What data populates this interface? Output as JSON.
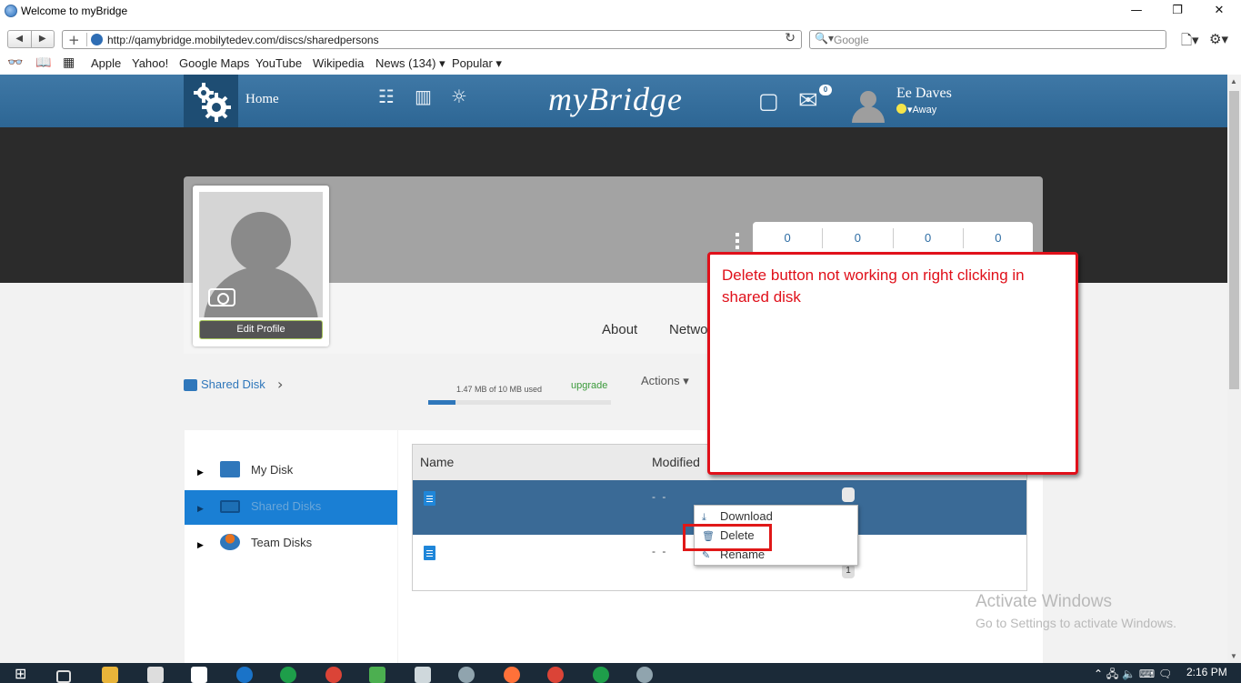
{
  "window": {
    "title": "Welcome to myBridge",
    "controls": [
      "—",
      "❐",
      "✕"
    ]
  },
  "browser": {
    "back_glyph": "◀",
    "forward_glyph": "▶",
    "new_tab_glyph": "+",
    "url": "http://qamybridge.mobilytedev.com/discs/sharedpersons",
    "reload_glyph": "↻",
    "search_glyph": "🔍▾",
    "search_placeholder": "Google",
    "page_menu_glyph": "🗋▾",
    "settings_glyph": "⚙▾",
    "bookmarks": [
      "Apple",
      "Yahoo!",
      "Google Maps",
      "YouTube",
      "Wikipedia",
      "News (134) ▾",
      "Popular ▾"
    ],
    "bookmark_icons": [
      "👓",
      "📖",
      "▦"
    ]
  },
  "header": {
    "home_label": "Home",
    "brand": "myBridge",
    "icons": [
      "tree-icon",
      "buildings-icon",
      "lightbulb-icon",
      "notes-icon",
      "mail-icon"
    ],
    "icon_glyphs": [
      "☷",
      "▥",
      "☼",
      "▢",
      "✉"
    ],
    "message_count": "0",
    "user_name": "Ee Daves",
    "user_status": "▾Away"
  },
  "profile": {
    "edit_label": "Edit Profile",
    "counts": [
      "0",
      "0",
      "0",
      "0"
    ],
    "tabs": [
      "About",
      "Netwo"
    ]
  },
  "disk": {
    "breadcrumb": "Shared Disk",
    "breadcrumb_arrow": "›",
    "usage_text": "1.47 MB of 10 MB used",
    "usage_fraction": 0.147,
    "upgrade_label": "upgrade",
    "actions_label": "Actions ▾",
    "sidebar": [
      {
        "label": "My Disk",
        "icon": "folder-icon",
        "color": "#2f77bb",
        "active": false
      },
      {
        "label": "Shared Disks",
        "icon": "monitor-icon",
        "color": "#1d6fb5",
        "active": true
      },
      {
        "label": "Team Disks",
        "icon": "team-icon",
        "color": "#e8731f",
        "active": false
      }
    ],
    "expand_glyph": "▶",
    "table": {
      "headers": [
        "Name",
        "Modified"
      ],
      "rows": [
        {
          "modified": "- -",
          "pill": "",
          "selected": true
        },
        {
          "modified": "- -",
          "pill": "1",
          "selected": false
        }
      ]
    },
    "context_menu": [
      {
        "label": "Download",
        "glyph": "⤓"
      },
      {
        "label": "Delete",
        "glyph": "🗑"
      },
      {
        "label": "Rename",
        "glyph": "✎"
      }
    ]
  },
  "annotation": {
    "text": "Delete button not working on right clicking in shared disk"
  },
  "watermark": {
    "line1": "Activate Windows",
    "line2": "Go to Settings to activate Windows."
  },
  "taskbar": {
    "time": "2:16 PM"
  },
  "colors": {
    "header": "#2d6694",
    "accent": "#1a7fd4",
    "annotation": "#e0101a"
  }
}
